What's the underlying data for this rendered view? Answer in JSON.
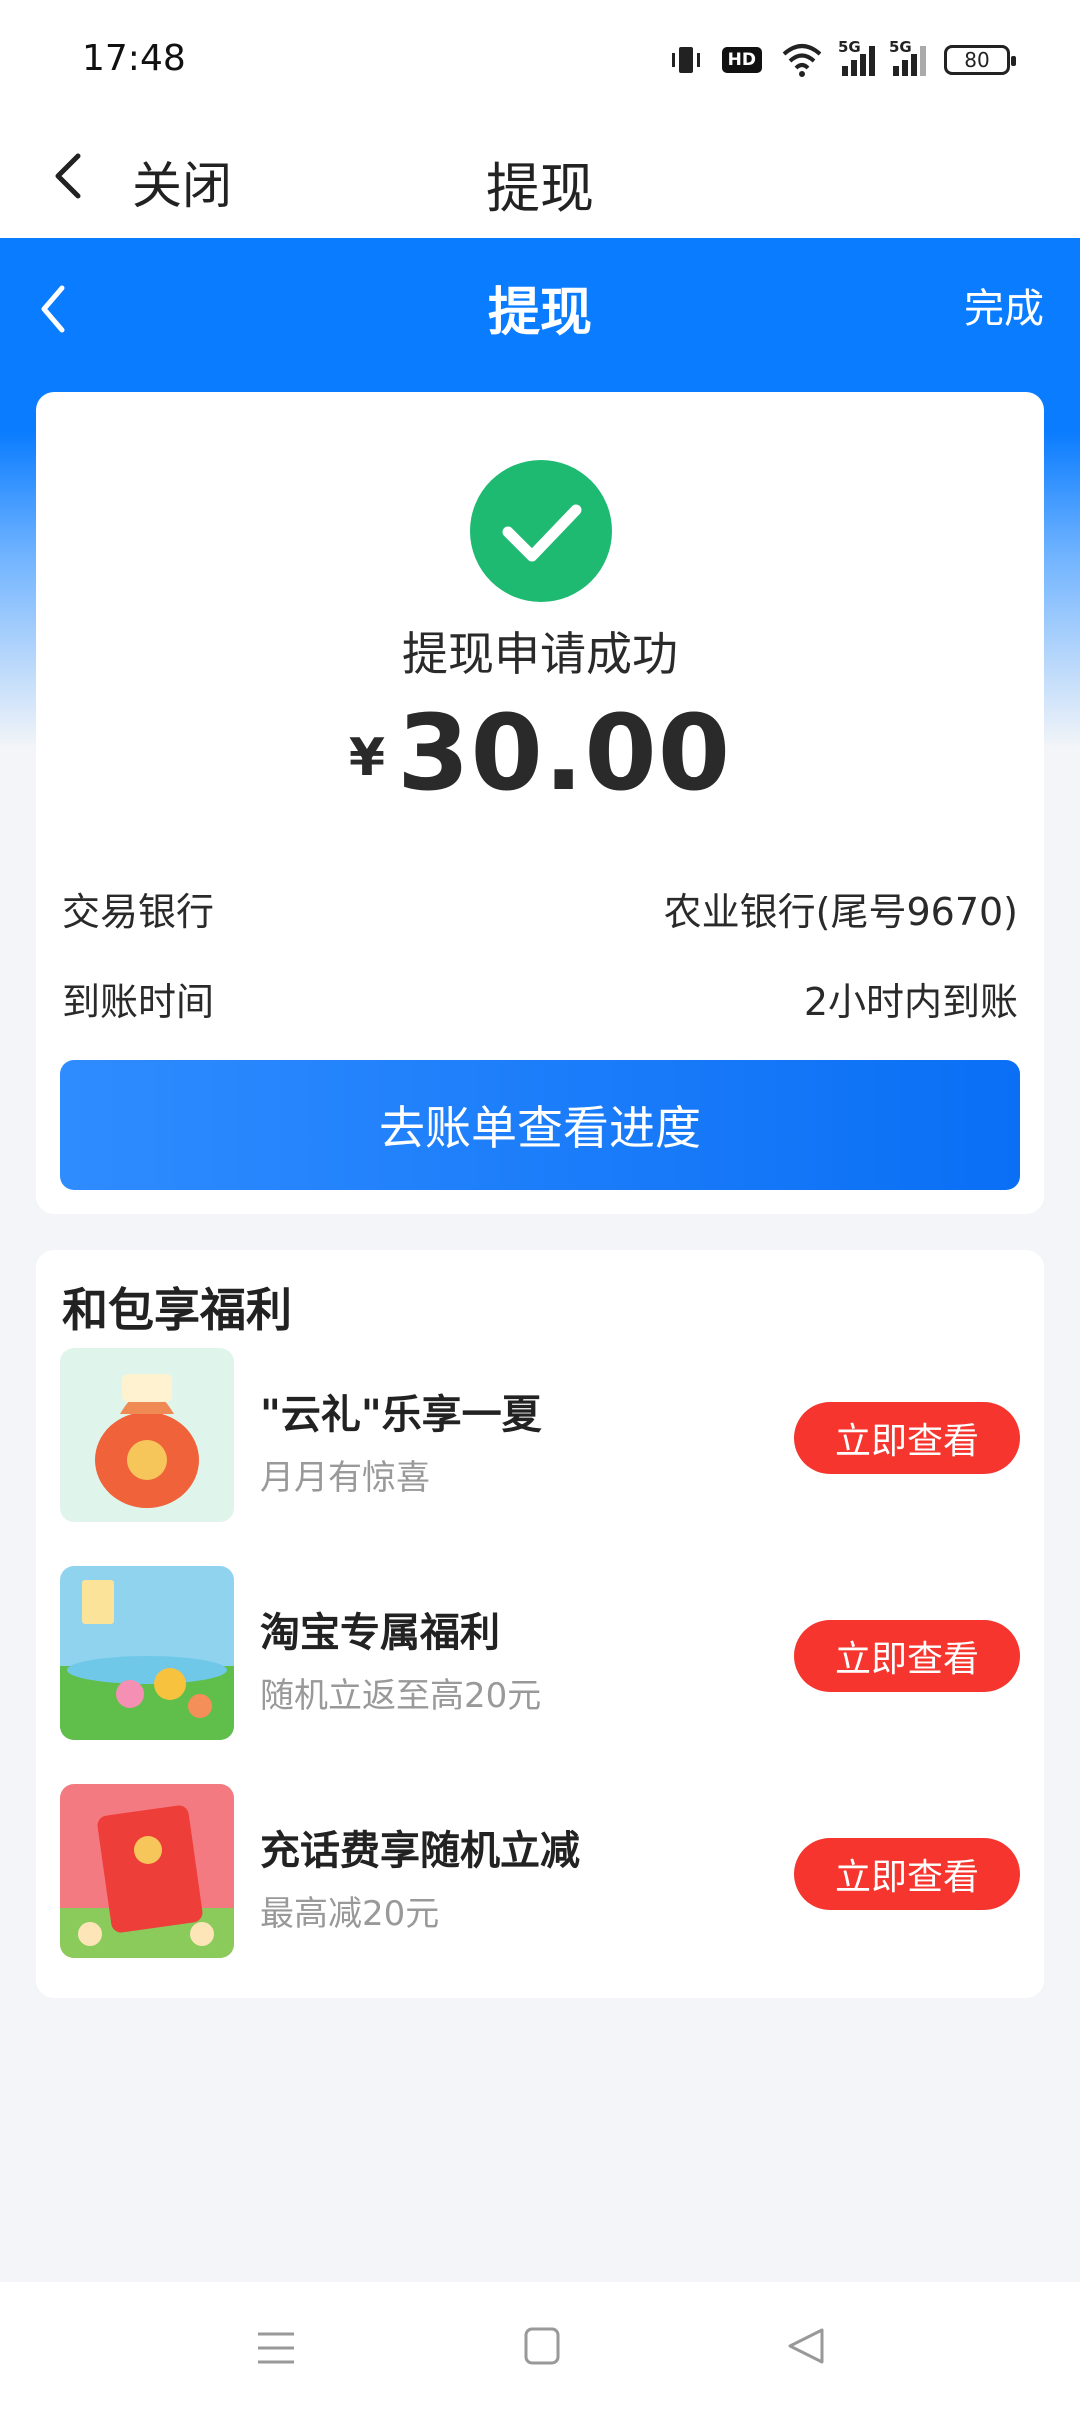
{
  "status_bar": {
    "time": "17:48",
    "hd_label": "HD",
    "network_label_1": "5G",
    "network_label_2": "5G",
    "battery": "80"
  },
  "top_header": {
    "close_label": "关闭",
    "title": "提现"
  },
  "inner_nav": {
    "title": "提现",
    "done_label": "完成"
  },
  "result": {
    "status_text": "提现申请成功",
    "currency_symbol": "¥",
    "amount": "30.00",
    "rows": [
      {
        "label": "交易银行",
        "value": "农业银行(尾号9670)"
      },
      {
        "label": "到账时间",
        "value": "2小时内到账"
      }
    ],
    "progress_button": "去账单查看进度"
  },
  "benefits": {
    "title": "和包享福利",
    "items": [
      {
        "name": "\"云礼\"乐享一夏",
        "subtitle": "月月有惊喜",
        "button": "立即查看"
      },
      {
        "name": "淘宝专属福利",
        "subtitle": "随机立返至高20元",
        "button": "立即查看"
      },
      {
        "name": "充话费享随机立减",
        "subtitle": "最高减20元",
        "button": "立即查看"
      }
    ]
  },
  "colors": {
    "brand_blue": "#0a7cff",
    "success_green": "#1fba72",
    "action_red": "#f5352e"
  }
}
